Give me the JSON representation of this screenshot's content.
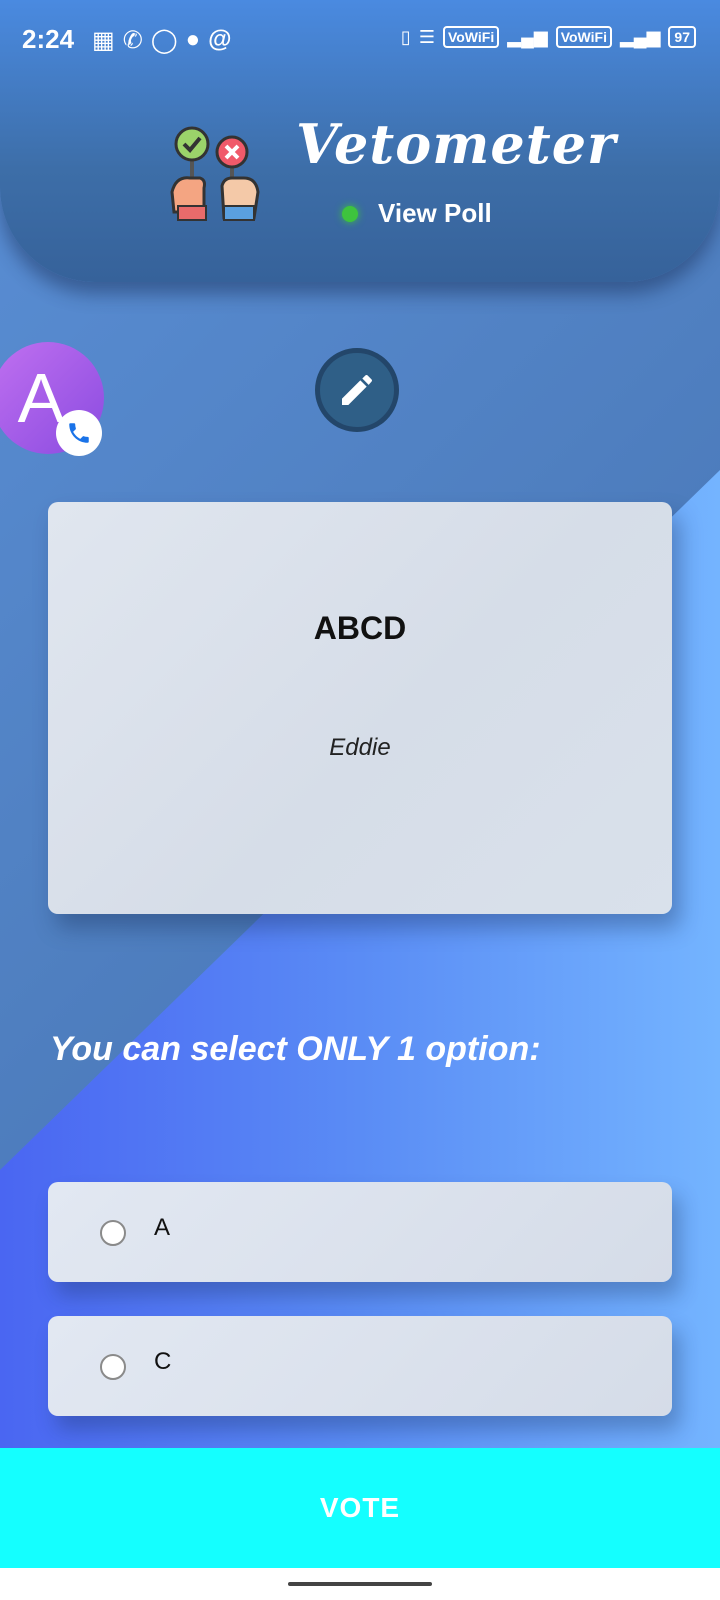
{
  "status_bar": {
    "time": "2:24",
    "left_icons": [
      "gallery-icon",
      "call-icon",
      "whatsapp-icon",
      "whatsapp-call-icon",
      "at-icon"
    ],
    "vowifi_1": "VoWiFi",
    "vowifi_2": "VoWiFi",
    "battery": "97"
  },
  "header": {
    "app_name": "Vetometer",
    "status_label": "View Poll",
    "status_color": "#3ec33e"
  },
  "avatar": {
    "letter": "A"
  },
  "poll": {
    "title": "ABCD",
    "author": "Eddie"
  },
  "instruction": "You can select ONLY 1 option:",
  "options": [
    {
      "label": "A",
      "selected": false
    },
    {
      "label": "C",
      "selected": false
    }
  ],
  "vote_button": {
    "label": "VOTE",
    "color": "#14ffff"
  }
}
